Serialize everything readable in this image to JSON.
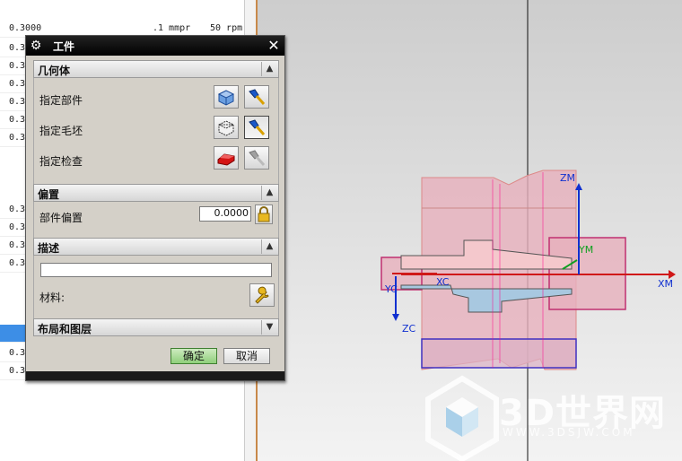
{
  "background_table": {
    "rows": [
      {
        "col1": "0.3000",
        "col2": ".1 mmpr",
        "col3": "50 rpm"
      },
      {
        "col1": "0.3",
        "col2": "",
        "col3": ""
      },
      {
        "col1": "0.3",
        "col2": "",
        "col3": ""
      },
      {
        "col1": "0.3",
        "col2": "",
        "col3": ""
      },
      {
        "col1": "0.3",
        "col2": "",
        "col3": ""
      },
      {
        "col1": "0.3",
        "col2": "",
        "col3": ""
      },
      {
        "col1": "0.3",
        "col2": "",
        "col3": ""
      },
      {
        "col1": "0.3",
        "col2": "",
        "col3": ""
      },
      {
        "col1": "0.3",
        "col2": "",
        "col3": ""
      },
      {
        "col1": "0.3",
        "col2": "",
        "col3": ""
      },
      {
        "col1": "0.3",
        "col2": "",
        "col3": ""
      },
      {
        "col1": "0.3",
        "col2": "",
        "col3": ""
      },
      {
        "col1": "0.3",
        "col2": "",
        "col3": ""
      }
    ]
  },
  "dialog": {
    "title": "工件",
    "sections": {
      "geometry": {
        "title": "几何体",
        "specify_part": "指定部件",
        "specify_blank": "指定毛坯",
        "specify_check": "指定检查"
      },
      "offset": {
        "title": "偏置",
        "part_offset_label": "部件偏置",
        "part_offset_value": "0.0000"
      },
      "description": {
        "title": "描述",
        "text_value": "",
        "material_label": "材料:"
      },
      "layout": {
        "title": "布局和图层"
      }
    },
    "ok_label": "确定",
    "cancel_label": "取消"
  },
  "viewport": {
    "axis_labels": {
      "zm": "ZM",
      "ym": "YM",
      "xm": "XM",
      "xc": "XC",
      "yc": "YC",
      "zc": "ZC"
    },
    "colors": {
      "part_fill": "#e8a8b8",
      "axis_red": "#d01818",
      "axis_blue": "#1030d0",
      "axis_green": "#10a020"
    }
  },
  "watermark": {
    "text": "3D世界网",
    "url": "WWW.3DSJW.COM"
  }
}
